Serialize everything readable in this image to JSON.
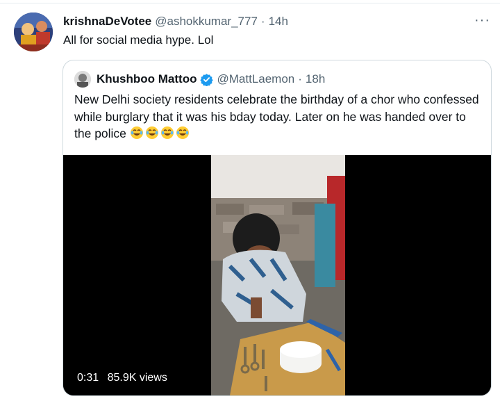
{
  "tweet": {
    "author_name": "krishnaDeVotee",
    "handle": "@ashokkumar_777",
    "separator": "·",
    "time": "14h",
    "text": "All for social media hype. Lol",
    "more_label": "···"
  },
  "quoted": {
    "author_name": "Khushboo Mattoo",
    "verified": true,
    "handle": "@MattLaemon",
    "separator": "·",
    "time": "18h",
    "text": "New Delhi society residents celebrate the birthday of a chor who confessed while burglary that it was his bday today. Later on he was handed over to the police",
    "emojis": [
      "face-with-tears-of-joy",
      "face-with-tears-of-joy",
      "face-with-tears-of-joy",
      "face-with-tears-of-joy"
    ],
    "video": {
      "duration": "0:31",
      "views": "85.9K views"
    }
  },
  "colors": {
    "text": "#0f1419",
    "secondary": "#536471",
    "border": "#cfd9de",
    "verified_blue": "#1d9bf0"
  }
}
